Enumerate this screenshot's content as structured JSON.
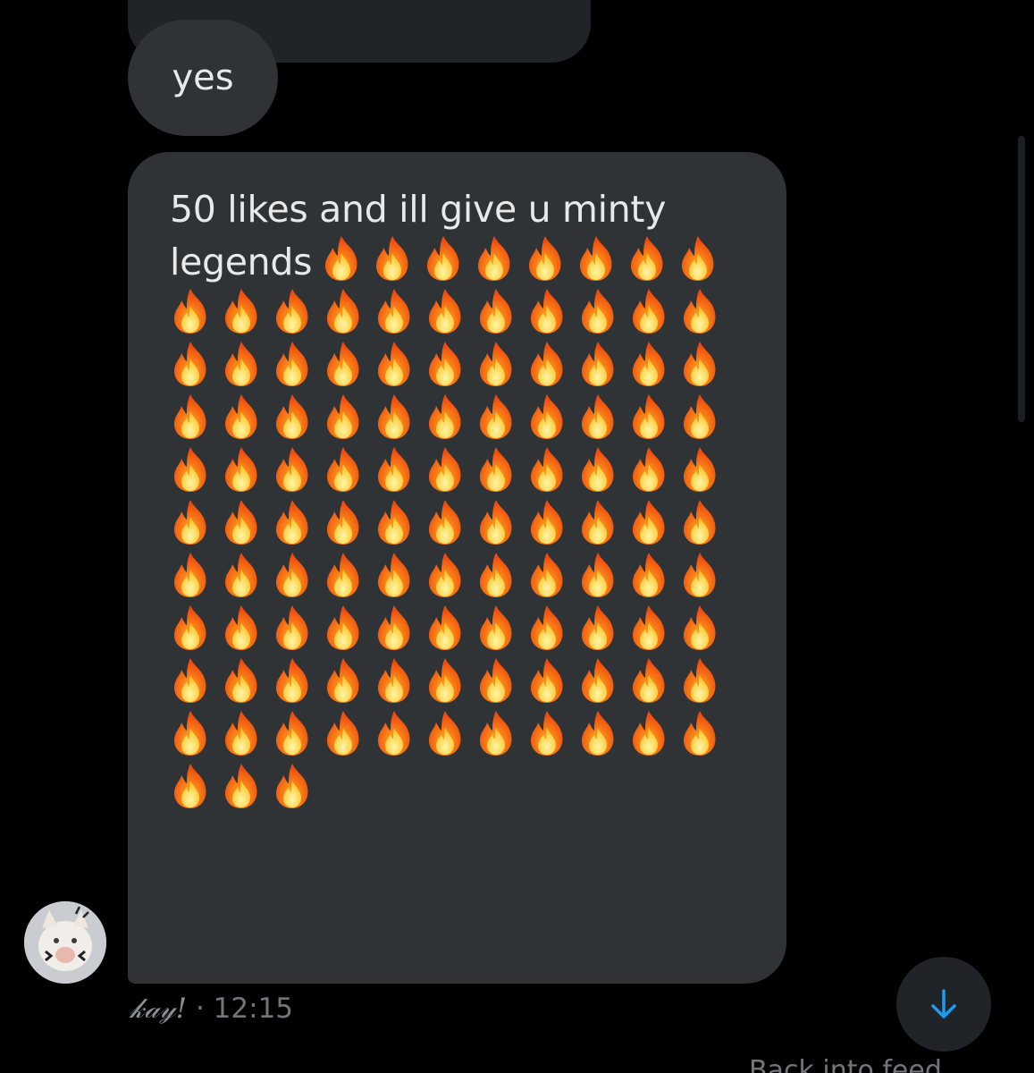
{
  "conversation": {
    "prev_bubble_text": "",
    "yes_message": "yes",
    "main_message": {
      "text": "50 likes and ill give u minty legends",
      "emoji": "🔥",
      "emoji_count": 110,
      "emoji_name": "fire-emoji"
    },
    "sender": {
      "name": "𝓀𝒶𝓎!",
      "separator": " · ",
      "time": "12:15",
      "avatar_icon": "cat-avatar"
    }
  },
  "controls": {
    "scroll_down_icon": "arrow-down-icon",
    "accent_color": "#1d9bf0"
  },
  "footer_peek": "Back into feed"
}
